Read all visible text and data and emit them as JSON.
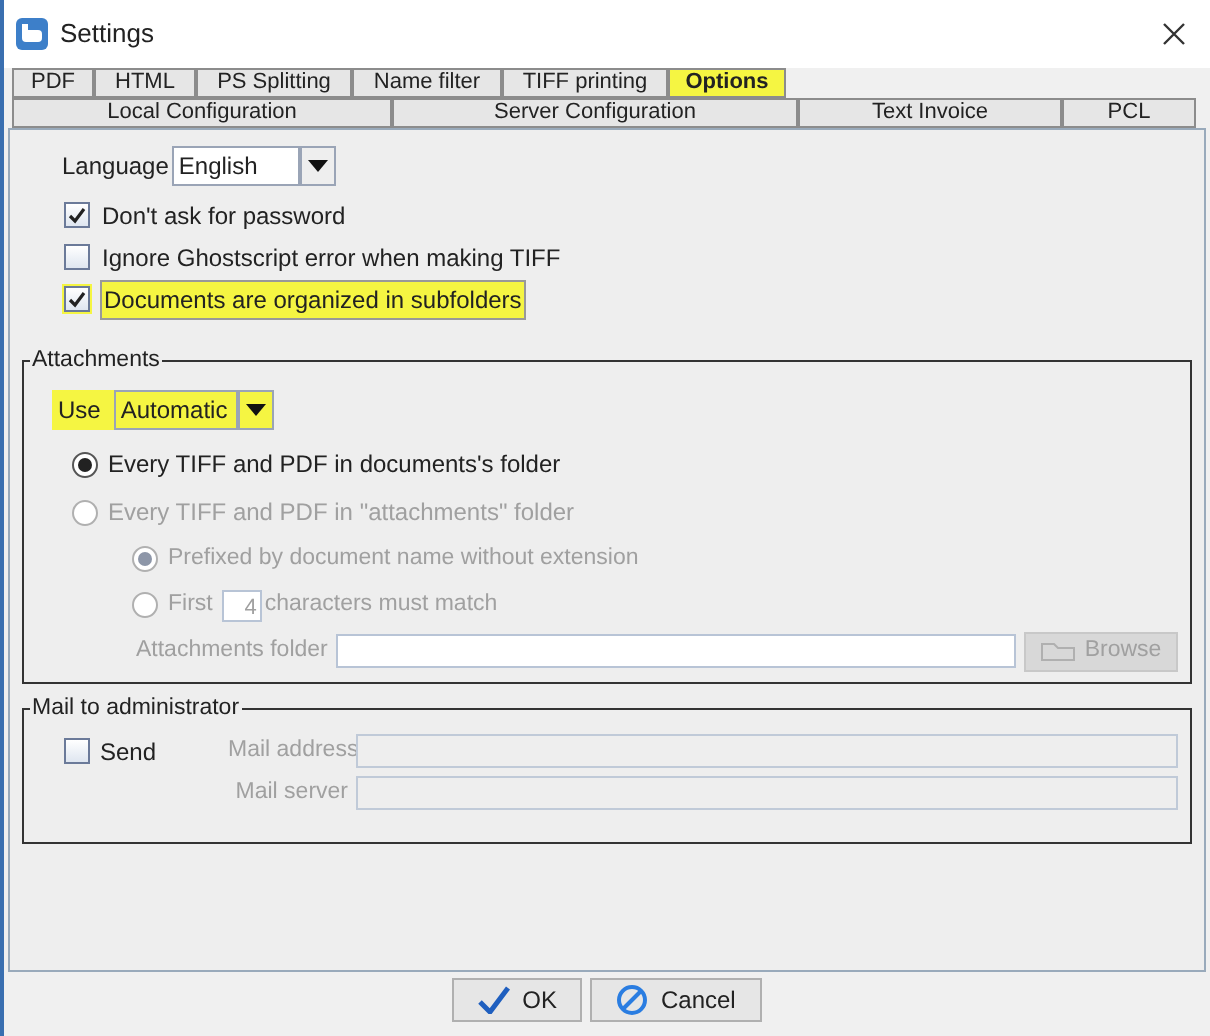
{
  "window": {
    "title": "Settings"
  },
  "tab_rows": [
    [
      {
        "label": "PDF",
        "selected": false,
        "highlighted": false
      },
      {
        "label": "HTML",
        "selected": false,
        "highlighted": false
      },
      {
        "label": "PS Splitting",
        "selected": false,
        "highlighted": false
      },
      {
        "label": "Name filter",
        "selected": false,
        "highlighted": false
      },
      {
        "label": "TIFF printing",
        "selected": false,
        "highlighted": false
      },
      {
        "label": "Options",
        "selected": true,
        "highlighted": true
      }
    ],
    [
      {
        "label": "Local Configuration",
        "selected": false,
        "highlighted": false
      },
      {
        "label": "Server Configuration",
        "selected": false,
        "highlighted": false
      },
      {
        "label": "Text Invoice",
        "selected": false,
        "highlighted": false
      },
      {
        "label": "PCL",
        "selected": false,
        "highlighted": false
      }
    ]
  ],
  "language": {
    "label": "Language",
    "value": "English"
  },
  "options": [
    {
      "label": "Don't ask for password",
      "checked": true,
      "highlighted": false
    },
    {
      "label": "Ignore Ghostscript error when making TIFF",
      "checked": false,
      "highlighted": false
    },
    {
      "label": "Documents are organized in subfolders",
      "checked": true,
      "highlighted": true
    }
  ],
  "attachments": {
    "title": "Attachments",
    "use": {
      "label": "Use",
      "value": "Automatic",
      "highlighted": true
    },
    "radios": [
      {
        "label": "Every TIFF and PDF in documents's folder",
        "selected": true,
        "disabled": false
      },
      {
        "label": "Every TIFF and PDF in \"attachments\" folder",
        "selected": false,
        "disabled": true,
        "children": [
          {
            "kind": "plain",
            "label": "Prefixed by document name without extension",
            "selected": true,
            "disabled": true
          },
          {
            "kind": "count",
            "label": "First",
            "value": "4",
            "suffix": "characters must match",
            "selected": false,
            "disabled": true
          }
        ]
      }
    ],
    "folder": {
      "label": "Attachments folder",
      "disabled": true
    },
    "browse": {
      "label": "Browse",
      "disabled": true
    }
  },
  "mail": {
    "title": "Mail to administrator",
    "send": {
      "label": "Send",
      "checked": false
    },
    "fields": [
      {
        "label": "Mail address",
        "disabled": true
      },
      {
        "label": "Mail server",
        "disabled": true
      }
    ]
  },
  "buttons": [
    {
      "kind": "ok",
      "label": "OK"
    },
    {
      "kind": "cancel",
      "label": "Cancel"
    }
  ]
}
